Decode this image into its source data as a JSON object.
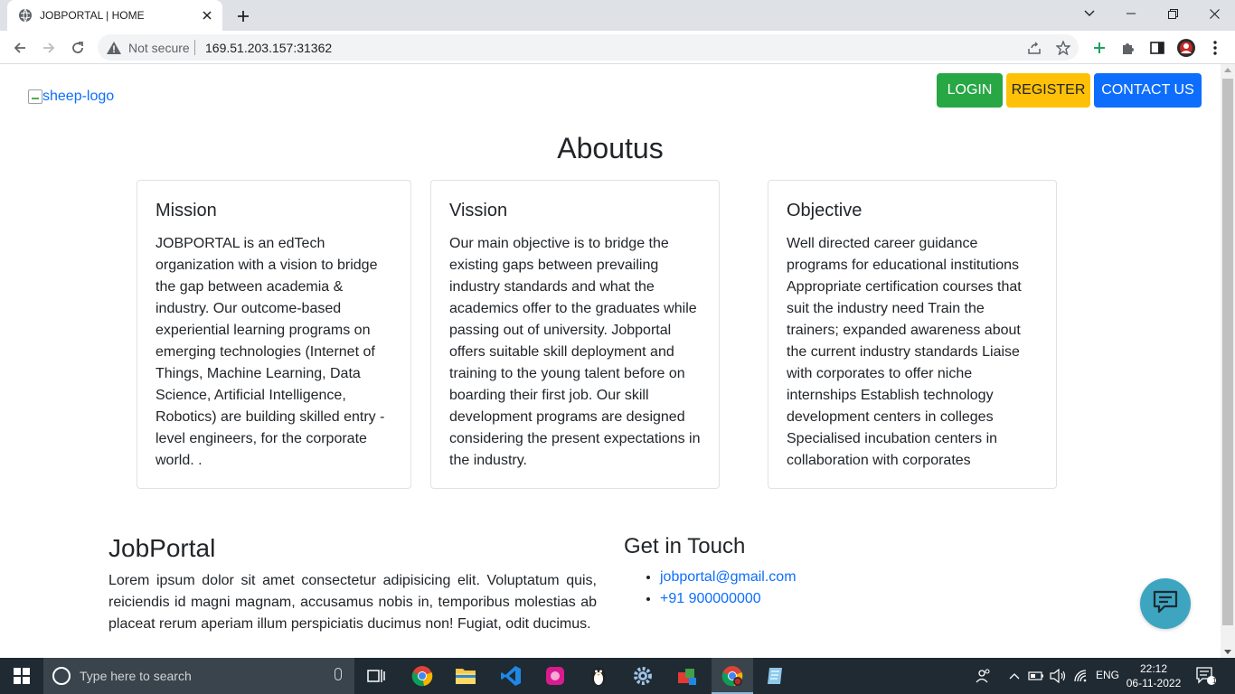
{
  "browser": {
    "tab_title": "JOBPORTAL | HOME",
    "security_label": "Not secure",
    "url": "169.51.203.157:31362"
  },
  "header": {
    "logo_alt": "sheep-logo",
    "buttons": {
      "login": "LOGIN",
      "register": "REGISTER",
      "contact": "CONTACT US"
    }
  },
  "about": {
    "heading": "Aboutus",
    "cards": [
      {
        "title": "Mission",
        "text": "JOBPORTAL is an edTech organization with a vision to bridge the gap between academia & industry. Our outcome-based experiential learning programs on emerging technologies (Internet of Things, Machine Learning, Data Science, Artificial Intelligence, Robotics) are building skilled entry -level engineers, for the corporate world. ."
      },
      {
        "title": "Vission",
        "text": "Our main objective is to bridge the existing gaps between prevailing industry standards and what the academics offer to the graduates while passing out of university. Jobportal offers suitable skill deployment and training to the young talent before on boarding their first job. Our skill development programs are designed considering the present expectations in the industry."
      },
      {
        "title": "Objective",
        "text": "Well directed career guidance programs for educational institutions Appropriate certification courses that suit the industry need Train the trainers; expanded awareness about the current industry standards Liaise with corporates to offer niche internships Establish technology development centers in colleges Specialised incubation centers in collaboration with corporates"
      }
    ]
  },
  "footer": {
    "title": "JobPortal",
    "text": "Lorem ipsum dolor sit amet consectetur adipisicing elit. Voluptatum quis, reiciendis id magni magnam, accusamus nobis in, temporibus molestias ab placeat rerum aperiam illum perspiciatis ducimus non! Fugiat, odit ducimus.",
    "touch_title": "Get in Touch",
    "email": "jobportal@gmail.com",
    "phone": "+91 900000000"
  },
  "taskbar": {
    "search_placeholder": "Type here to search",
    "language": "ENG",
    "time": "22:12",
    "date": "06-11-2022",
    "notification_count": "1"
  },
  "colors": {
    "login": "#28a745",
    "register": "#ffc107",
    "contact": "#0d6efd",
    "chat": "#3da5bf"
  }
}
